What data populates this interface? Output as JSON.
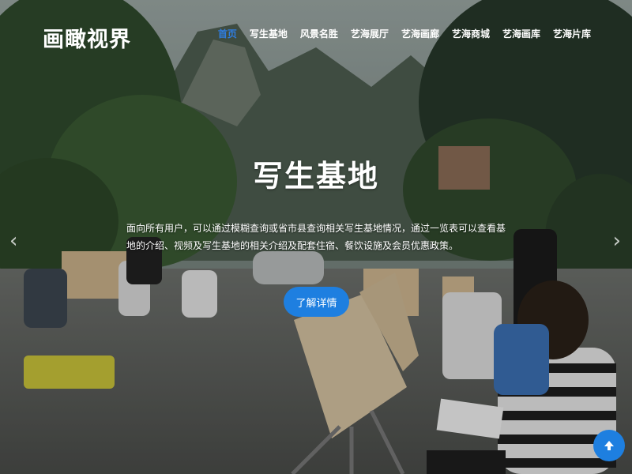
{
  "header": {
    "logo": "画瞰视界",
    "nav": [
      {
        "label": "首页",
        "active": true
      },
      {
        "label": "写生基地",
        "active": false
      },
      {
        "label": "风景名胜",
        "active": false
      },
      {
        "label": "艺海展厅",
        "active": false
      },
      {
        "label": "艺海画廊",
        "active": false
      },
      {
        "label": "艺海商城",
        "active": false
      },
      {
        "label": "艺海画库",
        "active": false
      },
      {
        "label": "艺海片库",
        "active": false
      }
    ]
  },
  "hero": {
    "title": "写生基地",
    "description": "面向所有用户，可以通过模糊查询或省市县查询相关写生基地情况，通过一览表可以查看基地的介绍、视频及写生基地的相关介绍及配套住宿、餐饮设施及会员优惠政策。",
    "cta_label": "了解详情",
    "prev_arrow": "‹",
    "next_arrow": "›"
  },
  "colors": {
    "accent": "#1e7fe0",
    "active_nav": "#2f7de0"
  },
  "icons": {
    "prev": "chevron-left-icon",
    "next": "chevron-right-icon",
    "back_to_top": "arrow-up-icon"
  }
}
